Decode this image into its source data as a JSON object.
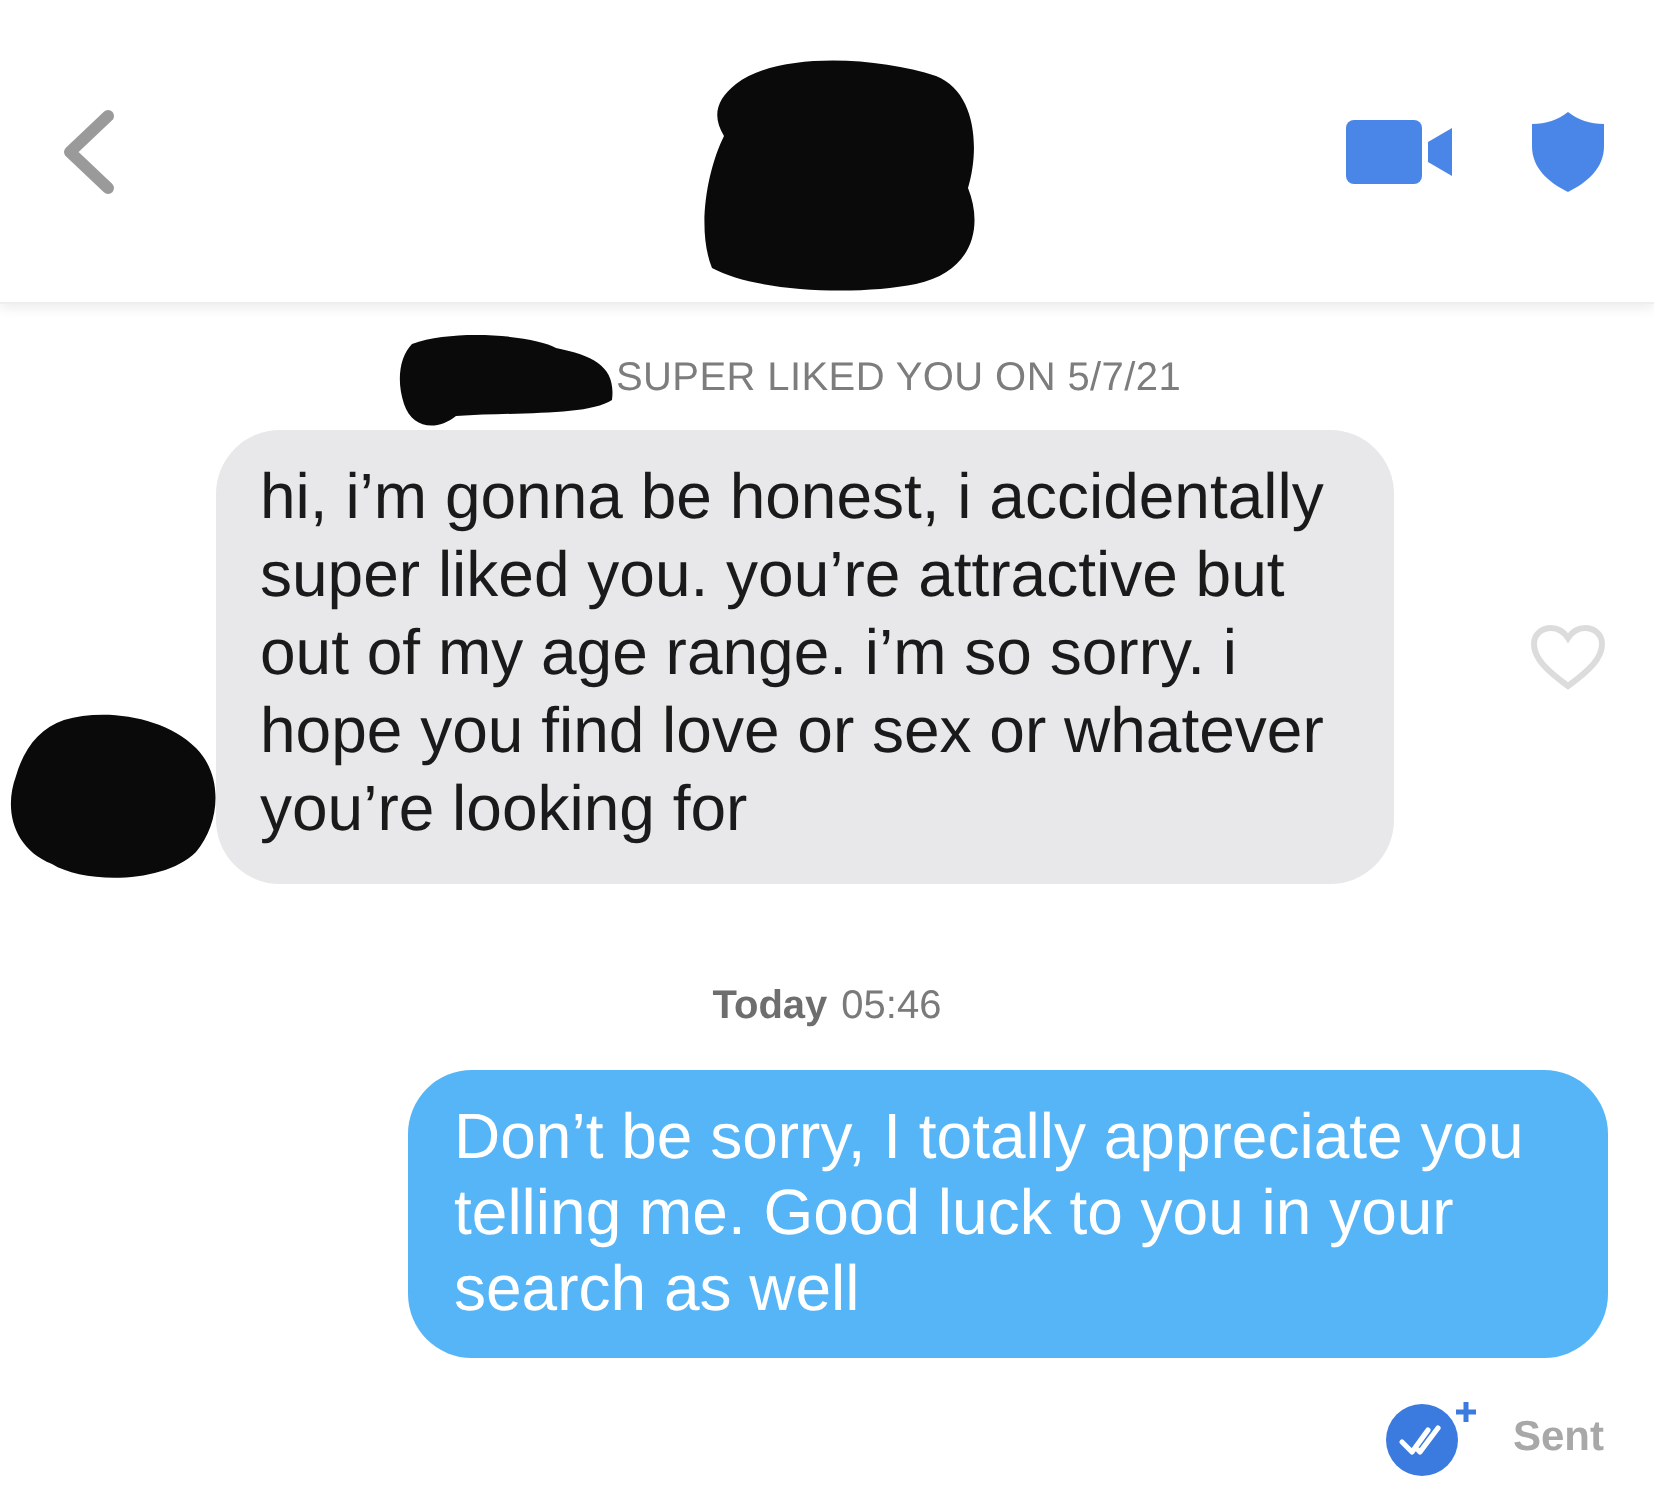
{
  "system_notice": "SUPER LIKED YOU ON 5/7/21",
  "messages": [
    {
      "kind": "incoming",
      "text": "hi, i’m gonna be honest, i accidentally super liked you. you’re attractive but out of my age range. i’m so sorry. i hope you find love or sex or whatever you’re looking for",
      "liked": false
    },
    {
      "kind": "timestamp",
      "day": "Today",
      "time": "05:46"
    },
    {
      "kind": "outgoing",
      "text": "Don’t be sorry, I totally appreciate you telling me. Good luck to you in your search as well"
    }
  ],
  "status": {
    "label": "Sent"
  }
}
